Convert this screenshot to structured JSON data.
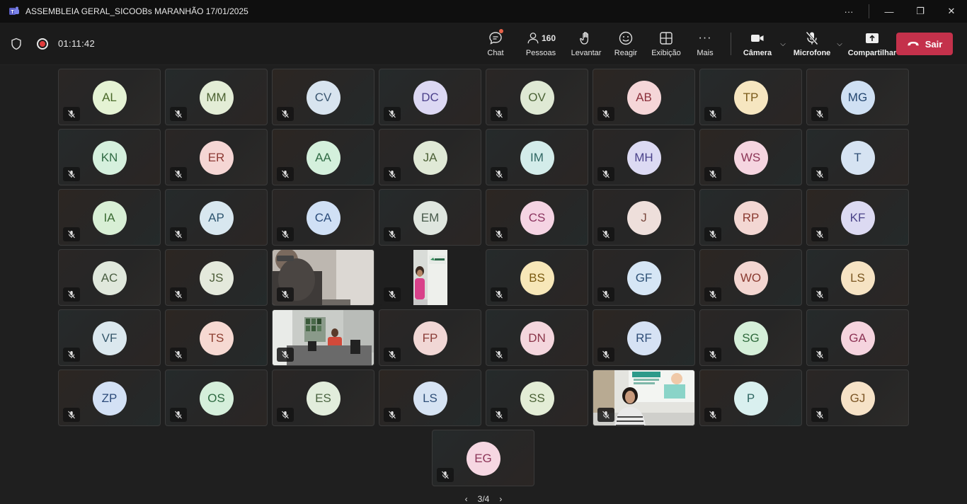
{
  "window": {
    "title": "ASSEMBLEIA GERAL_SICOOBs MARANHÃO 17/01/2025",
    "more": "···",
    "minimize": "—",
    "maximize": "❐",
    "close": "✕"
  },
  "toolbar": {
    "timer": "01:11:42",
    "chat_label": "Chat",
    "people_label": "Pessoas",
    "people_count": "160",
    "raise_label": "Levantar",
    "react_label": "Reagir",
    "view_label": "Exibição",
    "more_label": "Mais",
    "more_glyph": "···",
    "camera_label": "Câmera",
    "mic_label": "Microfone",
    "share_label": "Compartilhar",
    "leave_label": "Sair",
    "chevron": "⌵"
  },
  "participants": [
    {
      "initials": "AL",
      "bg": "#e5f3d4",
      "fg": "#4a6a2a"
    },
    {
      "initials": "MM",
      "bg": "#e3edd6",
      "fg": "#4b6130"
    },
    {
      "initials": "CV",
      "bg": "#d8e4ef",
      "fg": "#3a556f"
    },
    {
      "initials": "DC",
      "bg": "#dcd8f3",
      "fg": "#4a3f8a"
    },
    {
      "initials": "OV",
      "bg": "#dfe9d4",
      "fg": "#4a6235"
    },
    {
      "initials": "AB",
      "bg": "#f5d6d8",
      "fg": "#8a2f3a"
    },
    {
      "initials": "TP",
      "bg": "#f6e6c0",
      "fg": "#7a5a1a"
    },
    {
      "initials": "MG",
      "bg": "#cfe0f3",
      "fg": "#23466f"
    },
    {
      "initials": "KN",
      "bg": "#d5f0dd",
      "fg": "#2f6a43"
    },
    {
      "initials": "ER",
      "bg": "#f5d6d4",
      "fg": "#8c3a34"
    },
    {
      "initials": "AA",
      "bg": "#d4f0dc",
      "fg": "#2f6a44"
    },
    {
      "initials": "JA",
      "bg": "#e0e9d6",
      "fg": "#4c6036"
    },
    {
      "initials": "IM",
      "bg": "#d3ecea",
      "fg": "#2f6662"
    },
    {
      "initials": "MH",
      "bg": "#dcdaf3",
      "fg": "#4a428a"
    },
    {
      "initials": "WS",
      "bg": "#f5d5e0",
      "fg": "#8c3556"
    },
    {
      "initials": "T",
      "bg": "#d6e3f2",
      "fg": "#2f4e74"
    },
    {
      "initials": "IA",
      "bg": "#d8efd5",
      "fg": "#3a6a32"
    },
    {
      "initials": "AP",
      "bg": "#d8e7ef",
      "fg": "#2f5670"
    },
    {
      "initials": "CA",
      "bg": "#d0e0f5",
      "fg": "#2b4c7a"
    },
    {
      "initials": "EM",
      "bg": "#dfe6df",
      "fg": "#47594a"
    },
    {
      "initials": "CS",
      "bg": "#f5d4e3",
      "fg": "#8c3560"
    },
    {
      "initials": "J",
      "bg": "#eedfdb",
      "fg": "#7a4a3f"
    },
    {
      "initials": "RP",
      "bg": "#f3d7d3",
      "fg": "#8a3a30"
    },
    {
      "initials": "KF",
      "bg": "#dcdaf2",
      "fg": "#4a4388"
    },
    {
      "initials": "AC",
      "bg": "#e0e8dc",
      "fg": "#4a5e42"
    },
    {
      "initials": "JS",
      "bg": "#e4e9dc",
      "fg": "#4e5e3a"
    },
    {
      "initials": "",
      "bg": "",
      "fg": ""
    },
    {
      "initials": "",
      "bg": "",
      "fg": ""
    },
    {
      "initials": "BS",
      "bg": "#f7e7b8",
      "fg": "#7a5a10"
    },
    {
      "initials": "GF",
      "bg": "#d6e6f5",
      "fg": "#2f5277"
    },
    {
      "initials": "WO",
      "bg": "#f3d6d1",
      "fg": "#8a3a30"
    },
    {
      "initials": "LS",
      "bg": "#f6e3c3",
      "fg": "#7a5620"
    },
    {
      "initials": "VF",
      "bg": "#dbe8ee",
      "fg": "#34566a"
    },
    {
      "initials": "TS",
      "bg": "#f6d9d2",
      "fg": "#8c3e30"
    },
    {
      "initials": "",
      "bg": "",
      "fg": ""
    },
    {
      "initials": "FP",
      "bg": "#f1d7d5",
      "fg": "#8a3d38"
    },
    {
      "initials": "DN",
      "bg": "#f4d6dd",
      "fg": "#8a3448"
    },
    {
      "initials": "RF",
      "bg": "#d6e2f4",
      "fg": "#2f4d77"
    },
    {
      "initials": "SG",
      "bg": "#d5efd9",
      "fg": "#2f6a3c"
    },
    {
      "initials": "GA",
      "bg": "#f5d4de",
      "fg": "#8c3354"
    },
    {
      "initials": "ZP",
      "bg": "#d3e1f5",
      "fg": "#2c4b7a"
    },
    {
      "initials": "OS",
      "bg": "#d5efdb",
      "fg": "#2f6a42"
    },
    {
      "initials": "ES",
      "bg": "#e2eddc",
      "fg": "#4a6340"
    },
    {
      "initials": "LS",
      "bg": "#d6e3f3",
      "fg": "#2f4f78"
    },
    {
      "initials": "SS",
      "bg": "#e3edd6",
      "fg": "#4b6236"
    },
    {
      "initials": "",
      "bg": "",
      "fg": ""
    },
    {
      "initials": "P",
      "bg": "#d9f0ef",
      "fg": "#2f6662"
    },
    {
      "initials": "GJ",
      "bg": "#f6e2c7",
      "fg": "#7a5424"
    },
    {
      "initials": "EG",
      "bg": "#f6d7e2",
      "fg": "#8c3558"
    }
  ],
  "pager": {
    "prev": "‹",
    "label": "3/4",
    "next": "›"
  }
}
